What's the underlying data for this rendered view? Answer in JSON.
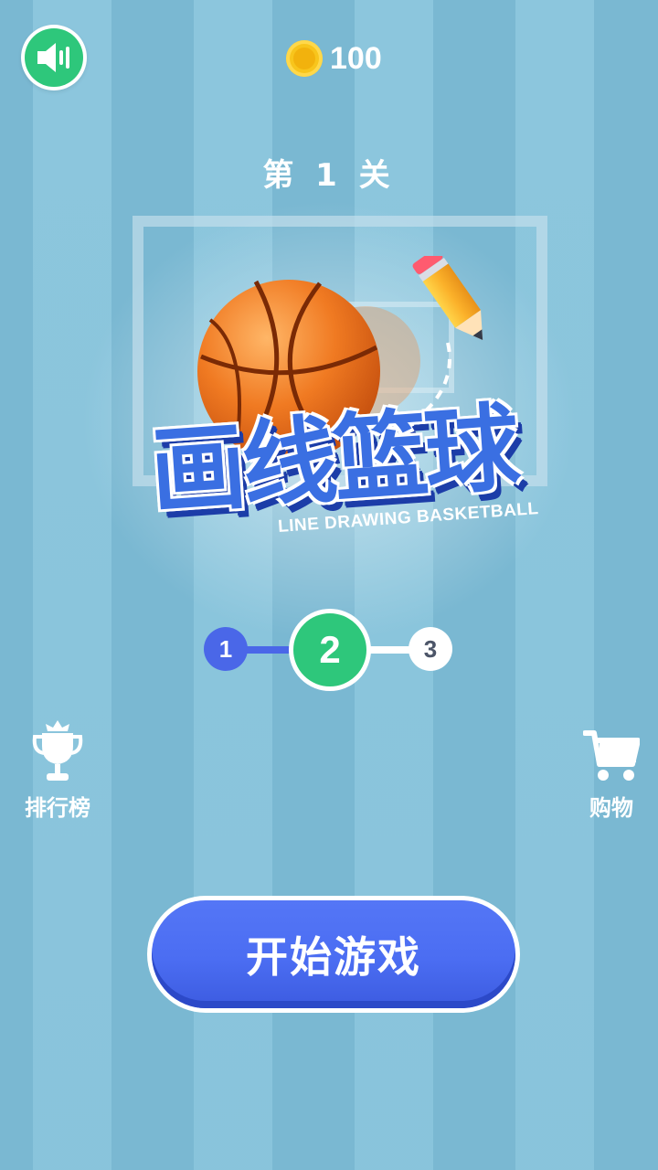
{
  "header": {
    "sound_icon": "speaker-icon",
    "coin_icon": "coin-icon",
    "coins": "100"
  },
  "level": {
    "title": "第 1 关"
  },
  "logo": {
    "title": "画线篮球",
    "subtitle": "LINE DRAWING BASKETBALL"
  },
  "stepper": {
    "steps": [
      "1",
      "2",
      "3"
    ],
    "current": "2",
    "colors": {
      "done": "#4a67e8",
      "current": "#2ec77b",
      "upcoming": "#ffffff"
    }
  },
  "sidebar": {
    "leaderboard": {
      "icon": "trophy-icon",
      "label": "排行榜"
    },
    "shop": {
      "icon": "shopping-cart-icon",
      "label": "购物"
    }
  },
  "start": {
    "label": "开始游戏"
  },
  "colors": {
    "accent": "#4b6df2",
    "green": "#2ec77b",
    "background": "#87c1d9"
  }
}
